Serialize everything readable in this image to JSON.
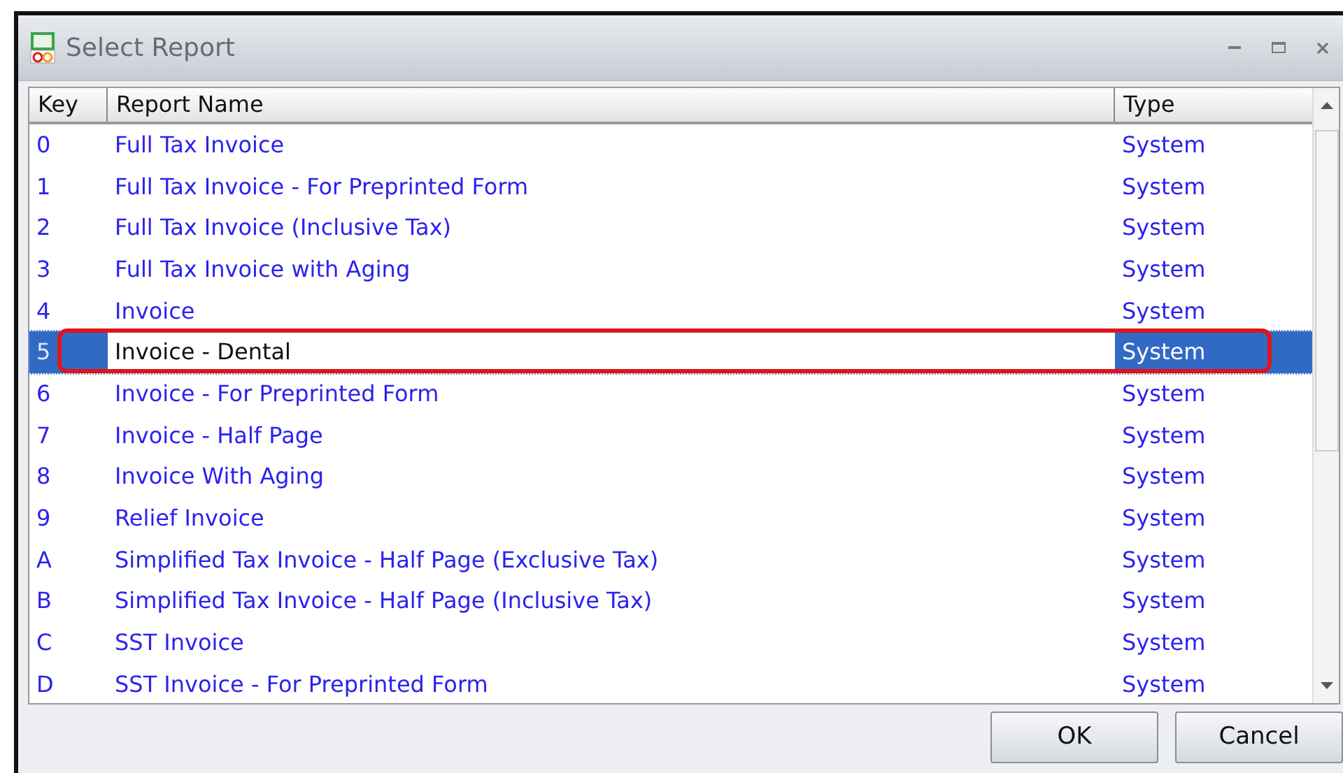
{
  "window": {
    "title": "Select Report"
  },
  "table": {
    "columns": [
      "Key",
      "Report Name",
      "Type"
    ],
    "rows": [
      {
        "key": "0",
        "name": "Full Tax Invoice",
        "type": "System",
        "selected": false,
        "circled": false
      },
      {
        "key": "1",
        "name": "Full Tax Invoice - For Preprinted Form",
        "type": "System",
        "selected": false,
        "circled": false
      },
      {
        "key": "2",
        "name": "Full Tax Invoice (Inclusive Tax)",
        "type": "System",
        "selected": false,
        "circled": false
      },
      {
        "key": "3",
        "name": "Full Tax Invoice with Aging",
        "type": "System",
        "selected": false,
        "circled": false
      },
      {
        "key": "4",
        "name": "Invoice",
        "type": "System",
        "selected": false,
        "circled": false
      },
      {
        "key": "5",
        "name": "Invoice - Dental",
        "type": "System",
        "selected": true,
        "circled": true
      },
      {
        "key": "6",
        "name": "Invoice - For Preprinted Form",
        "type": "System",
        "selected": false,
        "circled": false
      },
      {
        "key": "7",
        "name": "Invoice - Half Page",
        "type": "System",
        "selected": false,
        "circled": false
      },
      {
        "key": "8",
        "name": "Invoice With Aging",
        "type": "System",
        "selected": false,
        "circled": false
      },
      {
        "key": "9",
        "name": "Relief Invoice",
        "type": "System",
        "selected": false,
        "circled": false
      },
      {
        "key": "A",
        "name": "Simplified Tax Invoice - Half Page (Exclusive Tax)",
        "type": "System",
        "selected": false,
        "circled": false
      },
      {
        "key": "B",
        "name": "Simplified Tax Invoice - Half Page (Inclusive Tax)",
        "type": "System",
        "selected": false,
        "circled": false
      },
      {
        "key": "C",
        "name": "SST Invoice",
        "type": "System",
        "selected": false,
        "circled": false
      },
      {
        "key": "D",
        "name": "SST Invoice - For Preprinted Form",
        "type": "System",
        "selected": false,
        "circled": false
      }
    ]
  },
  "buttons": [
    "OK",
    "Cancel"
  ]
}
